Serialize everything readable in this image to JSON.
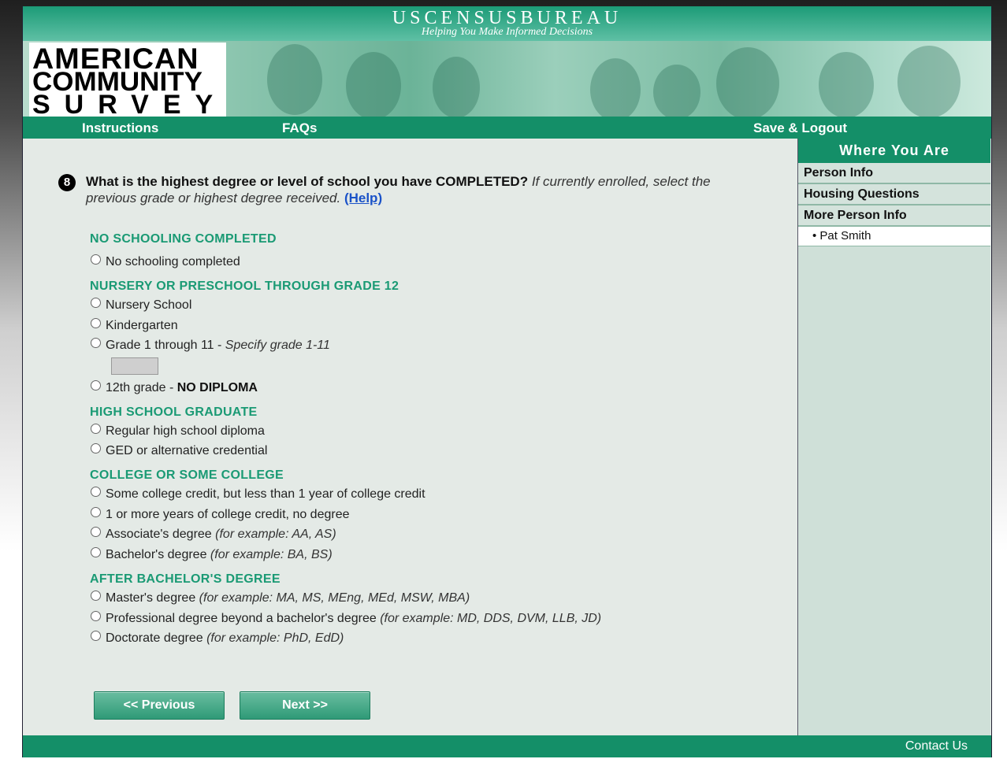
{
  "header": {
    "bureau_name": "USCENSUSBUREAU",
    "tagline": "Helping You Make Informed Decisions",
    "logo_lines": [
      "AMERICAN",
      "COMMUNITY",
      "SURVEY"
    ]
  },
  "nav": {
    "instructions": "Instructions",
    "faqs": "FAQs",
    "save_logout": "Save & Logout"
  },
  "sidebar": {
    "header": "Where You Are",
    "items": [
      "Person Info",
      "Housing Questions",
      "More Person Info"
    ],
    "subitem": "• Pat Smith"
  },
  "question": {
    "number": "8",
    "text_bold": "What is the highest degree or level of school you have COMPLETED?",
    "text_italic": "If currently enrolled, select the previous grade or highest degree received.",
    "help": "(Help)"
  },
  "sections": {
    "s1": "NO SCHOOLING COMPLETED",
    "s2": "NURSERY OR PRESCHOOL THROUGH GRADE 12",
    "s3": "HIGH SCHOOL GRADUATE",
    "s4": "COLLEGE OR SOME COLLEGE",
    "s5": "AFTER BACHELOR'S DEGREE"
  },
  "options": {
    "no_schooling": "No schooling completed",
    "nursery": "Nursery School",
    "kindergarten": "Kindergarten",
    "grade1_11": "Grade 1 through 11 - ",
    "grade1_11_italic": "Specify grade 1-11",
    "grade12": "12th grade - ",
    "grade12_bold": "NO DIPLOMA",
    "hs_diploma": "Regular high school diploma",
    "ged": "GED or alternative credential",
    "some_college": "Some college credit, but less than 1 year of college credit",
    "college_1plus": "1 or more years of college credit, no degree",
    "associate": "Associate's degree ",
    "associate_eg": "(for example: AA, AS)",
    "bachelor": "Bachelor's degree ",
    "bachelor_eg": "(for example: BA, BS)",
    "master": "Master's degree ",
    "master_eg": "(for example: MA, MS, MEng, MEd, MSW, MBA)",
    "professional": "Professional degree beyond a bachelor's degree ",
    "professional_eg": "(for example: MD, DDS, DVM, LLB, JD)",
    "doctorate": "Doctorate degree ",
    "doctorate_eg": "(for example: PhD, EdD)"
  },
  "grade_input_value": "",
  "buttons": {
    "previous": "<<   Previous",
    "next": "Next   >>"
  },
  "footer": {
    "contact": "Contact Us"
  }
}
